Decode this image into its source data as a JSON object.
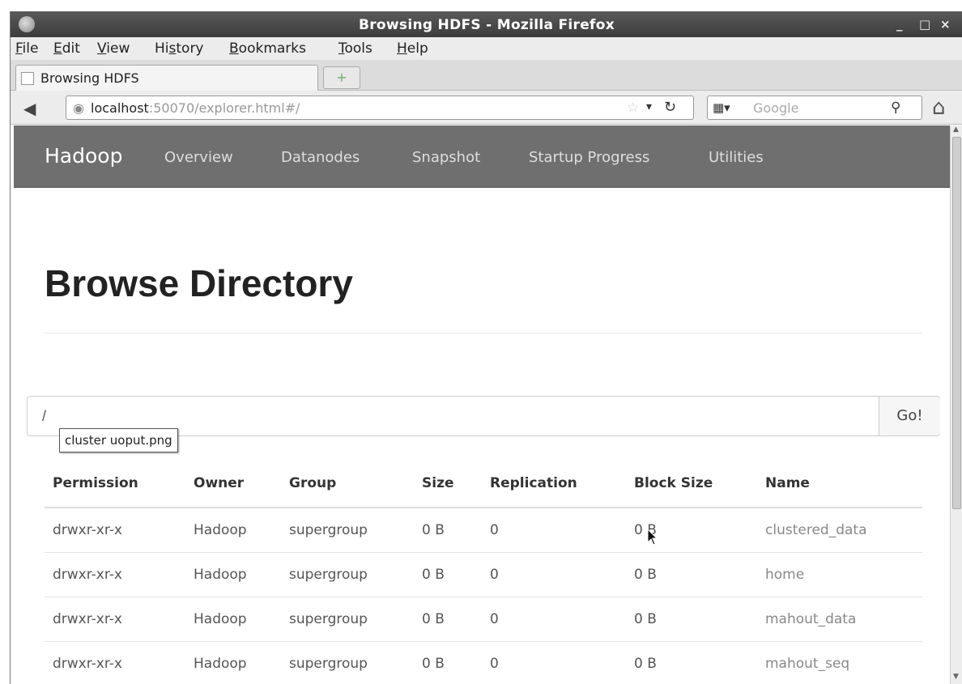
{
  "window": {
    "title": "Browsing HDFS - Mozilla Firefox",
    "controls": [
      "_",
      "□",
      "×"
    ]
  },
  "menubar": {
    "items": [
      {
        "pre": "",
        "u": "F",
        "post": "ile"
      },
      {
        "pre": "",
        "u": "E",
        "post": "dit"
      },
      {
        "pre": "",
        "u": "V",
        "post": "iew"
      },
      {
        "pre": "Hi",
        "u": "s",
        "post": "tory"
      },
      {
        "pre": "",
        "u": "B",
        "post": "ookmarks"
      },
      {
        "pre": "",
        "u": "T",
        "post": "ools"
      },
      {
        "pre": "",
        "u": "H",
        "post": "elp"
      }
    ]
  },
  "tabs": {
    "active_label": "Browsing HDFS",
    "new_tab_symbol": "+"
  },
  "navbar": {
    "url_host": "localhost",
    "url_rest": ":50070/explorer.html#/",
    "search_placeholder": "Google"
  },
  "hadoop_nav": {
    "brand": "Hadoop",
    "links": [
      "Overview",
      "Datanodes",
      "Snapshot",
      "Startup Progress",
      "Utilities"
    ]
  },
  "page": {
    "title": "Browse Directory",
    "path_value": "/",
    "go_label": "Go!",
    "tooltip": "cluster uoput.png"
  },
  "table": {
    "headers": [
      "Permission",
      "Owner",
      "Group",
      "Size",
      "Replication",
      "Block Size",
      "Name"
    ],
    "rows": [
      [
        "drwxr-xr-x",
        "Hadoop",
        "supergroup",
        "0 B",
        "0",
        "0 B",
        "clustered_data"
      ],
      [
        "drwxr-xr-x",
        "Hadoop",
        "supergroup",
        "0 B",
        "0",
        "0 B",
        "home"
      ],
      [
        "drwxr-xr-x",
        "Hadoop",
        "supergroup",
        "0 B",
        "0",
        "0 B",
        "mahout_data"
      ],
      [
        "drwxr-xr-x",
        "Hadoop",
        "supergroup",
        "0 B",
        "0",
        "0 B",
        "mahout_seq"
      ]
    ]
  }
}
